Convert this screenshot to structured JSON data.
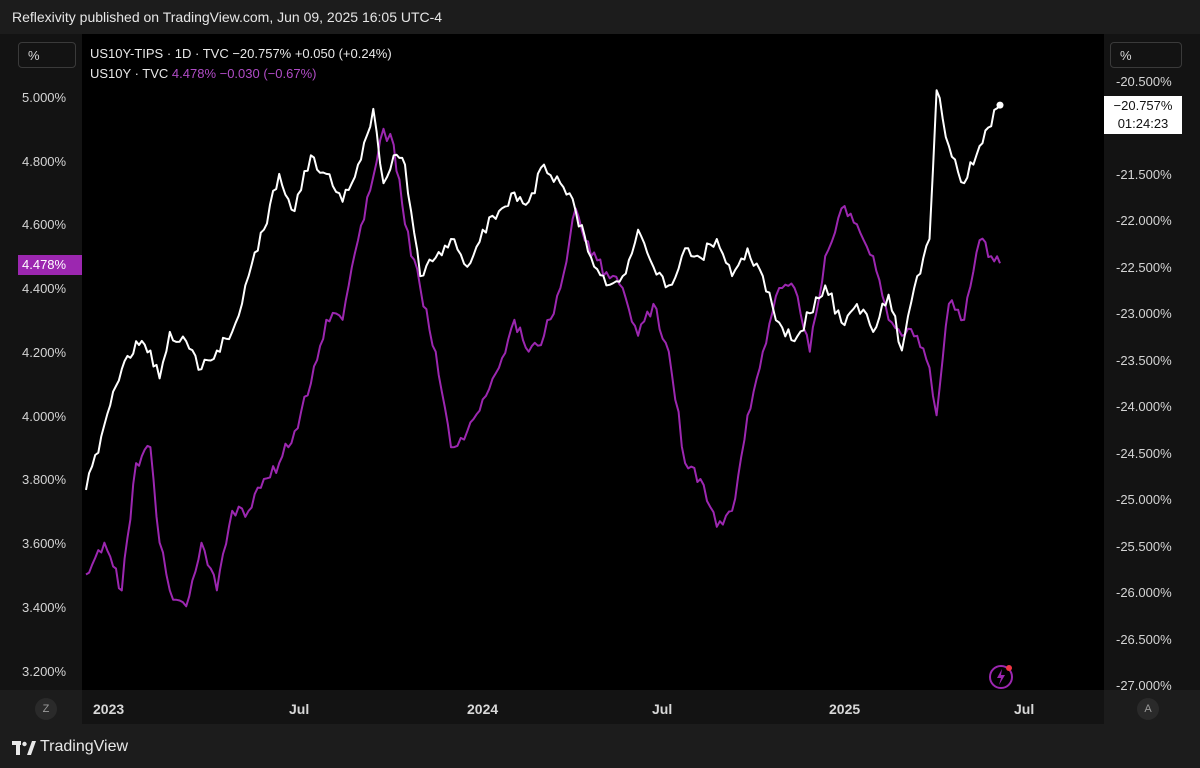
{
  "header": {
    "title": "Reflexivity published on TradingView.com, Jun 09, 2025 16:05 UTC-4"
  },
  "axes": {
    "left_unit": "%",
    "right_unit": "%",
    "left_ticks": [
      "5.000%",
      "4.800%",
      "4.600%",
      "4.400%",
      "4.200%",
      "4.000%",
      "3.800%",
      "3.600%",
      "3.400%",
      "3.200%"
    ],
    "right_ticks": [
      "-20.500%",
      "-21.000%",
      "-21.500%",
      "-22.000%",
      "-22.500%",
      "-23.000%",
      "-23.500%",
      "-24.000%",
      "-24.500%",
      "-25.000%",
      "-25.500%",
      "-26.000%",
      "-26.500%",
      "-27.000%"
    ],
    "x_ticks": [
      "2023",
      "Jul",
      "2024",
      "Jul",
      "2025",
      "Jul"
    ],
    "left_badge": "4.478%",
    "right_badge_value": "−20.757%",
    "right_badge_timer": "01:24:23",
    "corner_left": "Z",
    "corner_right": "A"
  },
  "legend": {
    "row1": "US10Y-TIPS · 1D · TVC  −20.757%  +0.050 (+0.24%)",
    "row2_name": "US10Y · TVC",
    "row2_values": "4.478%  −0.030 (−0.67%)"
  },
  "footer": {
    "brand": "TradingView"
  },
  "colors": {
    "tips": "#ffffff",
    "us10y": "#9c27b0",
    "background": "#000000"
  },
  "chart_data": {
    "type": "line",
    "x_range": [
      "2022-12-28",
      "2025-06-09"
    ],
    "series": [
      {
        "name": "US10Y-TIPS",
        "axis": "right",
        "unit": "%",
        "ylim": [
          -27.0,
          -20.5
        ],
        "color": "#ffffff",
        "x": [
          "2022-12-28",
          "2023-01-15",
          "2023-02-01",
          "2023-02-15",
          "2023-03-01",
          "2023-03-10",
          "2023-03-20",
          "2023-04-05",
          "2023-04-20",
          "2023-05-05",
          "2023-05-20",
          "2023-06-05",
          "2023-06-20",
          "2023-07-05",
          "2023-07-20",
          "2023-08-05",
          "2023-08-20",
          "2023-09-05",
          "2023-09-20",
          "2023-10-05",
          "2023-10-15",
          "2023-10-25",
          "2023-11-05",
          "2023-11-20",
          "2023-12-05",
          "2023-12-20",
          "2024-01-05",
          "2024-01-20",
          "2024-02-05",
          "2024-02-20",
          "2024-03-05",
          "2024-03-20",
          "2024-04-05",
          "2024-04-20",
          "2024-05-05",
          "2024-05-20",
          "2024-06-05",
          "2024-06-20",
          "2024-07-05",
          "2024-07-20",
          "2024-08-05",
          "2024-08-20",
          "2024-09-05",
          "2024-09-20",
          "2024-10-05",
          "2024-10-20",
          "2024-11-05",
          "2024-11-20",
          "2024-12-05",
          "2024-12-20",
          "2025-01-05",
          "2025-01-20",
          "2025-02-05",
          "2025-02-20",
          "2025-03-05",
          "2025-03-20",
          "2025-04-01",
          "2025-04-08",
          "2025-04-20",
          "2025-05-05",
          "2025-05-20",
          "2025-06-09"
        ],
        "values": [
          -24.9,
          -24.2,
          -23.6,
          -23.3,
          -23.4,
          -23.7,
          -23.2,
          -23.3,
          -23.6,
          -23.4,
          -23.2,
          -22.6,
          -22.1,
          -21.5,
          -21.9,
          -21.3,
          -21.5,
          -21.8,
          -21.4,
          -20.8,
          -21.6,
          -21.3,
          -21.4,
          -22.6,
          -22.4,
          -22.2,
          -22.5,
          -22.1,
          -21.9,
          -21.7,
          -21.8,
          -21.4,
          -21.6,
          -21.9,
          -22.4,
          -22.7,
          -22.6,
          -22.1,
          -22.5,
          -22.7,
          -22.3,
          -22.4,
          -22.2,
          -22.6,
          -22.3,
          -22.6,
          -23.1,
          -23.3,
          -23.0,
          -22.7,
          -23.1,
          -22.9,
          -23.2,
          -22.8,
          -23.4,
          -22.6,
          -22.2,
          -20.6,
          -21.2,
          -21.6,
          -21.2,
          -20.76
        ]
      },
      {
        "name": "US10Y",
        "axis": "left",
        "unit": "%",
        "ylim": [
          3.2,
          5.0
        ],
        "color": "#9c27b0",
        "x": [
          "2022-12-28",
          "2023-01-15",
          "2023-02-01",
          "2023-02-15",
          "2023-03-01",
          "2023-03-10",
          "2023-03-20",
          "2023-04-05",
          "2023-04-20",
          "2023-05-05",
          "2023-05-20",
          "2023-06-05",
          "2023-06-20",
          "2023-07-05",
          "2023-07-20",
          "2023-08-05",
          "2023-08-20",
          "2023-09-05",
          "2023-09-20",
          "2023-10-05",
          "2023-10-15",
          "2023-10-25",
          "2023-11-05",
          "2023-11-20",
          "2023-12-05",
          "2023-12-20",
          "2024-01-05",
          "2024-01-20",
          "2024-02-05",
          "2024-02-20",
          "2024-03-05",
          "2024-03-20",
          "2024-04-05",
          "2024-04-20",
          "2024-05-05",
          "2024-05-20",
          "2024-06-05",
          "2024-06-20",
          "2024-07-05",
          "2024-07-20",
          "2024-08-05",
          "2024-08-20",
          "2024-09-05",
          "2024-09-20",
          "2024-10-05",
          "2024-10-20",
          "2024-11-05",
          "2024-11-20",
          "2024-12-05",
          "2024-12-20",
          "2025-01-05",
          "2025-01-20",
          "2025-02-05",
          "2025-02-20",
          "2025-03-05",
          "2025-03-20",
          "2025-04-01",
          "2025-04-08",
          "2025-04-20",
          "2025-05-05",
          "2025-05-20",
          "2025-06-09"
        ],
        "values": [
          3.5,
          3.6,
          3.45,
          3.85,
          3.9,
          3.6,
          3.45,
          3.4,
          3.6,
          3.45,
          3.7,
          3.7,
          3.8,
          3.85,
          3.95,
          4.1,
          4.3,
          4.3,
          4.55,
          4.75,
          4.9,
          4.85,
          4.6,
          4.4,
          4.2,
          3.9,
          3.95,
          4.05,
          4.15,
          4.3,
          4.2,
          4.25,
          4.4,
          4.65,
          4.5,
          4.45,
          4.4,
          4.25,
          4.35,
          4.2,
          3.85,
          3.8,
          3.65,
          3.7,
          4.0,
          4.2,
          4.4,
          4.4,
          4.2,
          4.5,
          4.65,
          4.6,
          4.5,
          4.3,
          4.25,
          4.25,
          4.15,
          4.0,
          4.35,
          4.3,
          4.55,
          4.478
        ]
      }
    ]
  }
}
